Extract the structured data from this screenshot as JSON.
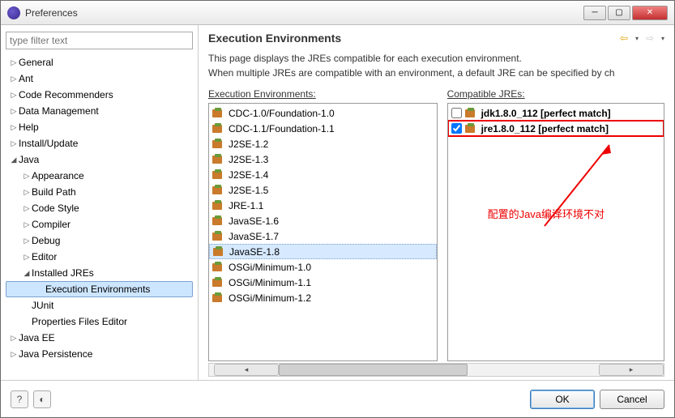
{
  "window": {
    "title": "Preferences"
  },
  "filter": {
    "placeholder": "type filter text"
  },
  "tree": [
    {
      "label": "General",
      "indent": 0,
      "expandable": true,
      "expanded": false
    },
    {
      "label": "Ant",
      "indent": 0,
      "expandable": true,
      "expanded": false
    },
    {
      "label": "Code Recommenders",
      "indent": 0,
      "expandable": true,
      "expanded": false
    },
    {
      "label": "Data Management",
      "indent": 0,
      "expandable": true,
      "expanded": false
    },
    {
      "label": "Help",
      "indent": 0,
      "expandable": true,
      "expanded": false
    },
    {
      "label": "Install/Update",
      "indent": 0,
      "expandable": true,
      "expanded": false
    },
    {
      "label": "Java",
      "indent": 0,
      "expandable": true,
      "expanded": true
    },
    {
      "label": "Appearance",
      "indent": 1,
      "expandable": true,
      "expanded": false
    },
    {
      "label": "Build Path",
      "indent": 1,
      "expandable": true,
      "expanded": false
    },
    {
      "label": "Code Style",
      "indent": 1,
      "expandable": true,
      "expanded": false
    },
    {
      "label": "Compiler",
      "indent": 1,
      "expandable": true,
      "expanded": false
    },
    {
      "label": "Debug",
      "indent": 1,
      "expandable": true,
      "expanded": false
    },
    {
      "label": "Editor",
      "indent": 1,
      "expandable": true,
      "expanded": false
    },
    {
      "label": "Installed JREs",
      "indent": 1,
      "expandable": true,
      "expanded": true
    },
    {
      "label": "Execution Environments",
      "indent": 2,
      "expandable": false,
      "selected": true
    },
    {
      "label": "JUnit",
      "indent": 1,
      "expandable": false
    },
    {
      "label": "Properties Files Editor",
      "indent": 1,
      "expandable": false
    },
    {
      "label": "Java EE",
      "indent": 0,
      "expandable": true,
      "expanded": false
    },
    {
      "label": "Java Persistence",
      "indent": 0,
      "expandable": true,
      "expanded": false
    }
  ],
  "main": {
    "heading": "Execution Environments",
    "desc1": "This page displays the JREs compatible for each execution environment.",
    "desc2": "When multiple JREs are compatible with an environment, a default JRE can be specified by ch",
    "envLabel": "Execution Environments:",
    "jreLabel": "Compatible JREs:"
  },
  "envs": [
    "CDC-1.0/Foundation-1.0",
    "CDC-1.1/Foundation-1.1",
    "J2SE-1.2",
    "J2SE-1.3",
    "J2SE-1.4",
    "J2SE-1.5",
    "JRE-1.1",
    "JavaSE-1.6",
    "JavaSE-1.7",
    "JavaSE-1.8",
    "OSGi/Minimum-1.0",
    "OSGi/Minimum-1.1",
    "OSGi/Minimum-1.2"
  ],
  "envSelected": 9,
  "jres": [
    {
      "name": "jdk1.8.0_112 [perfect match]",
      "checked": false
    },
    {
      "name": "jre1.8.0_112 [perfect match]",
      "checked": true,
      "highlight": true
    }
  ],
  "annotation": "配置的Java编译环境不对",
  "buttons": {
    "ok": "OK",
    "cancel": "Cancel"
  }
}
